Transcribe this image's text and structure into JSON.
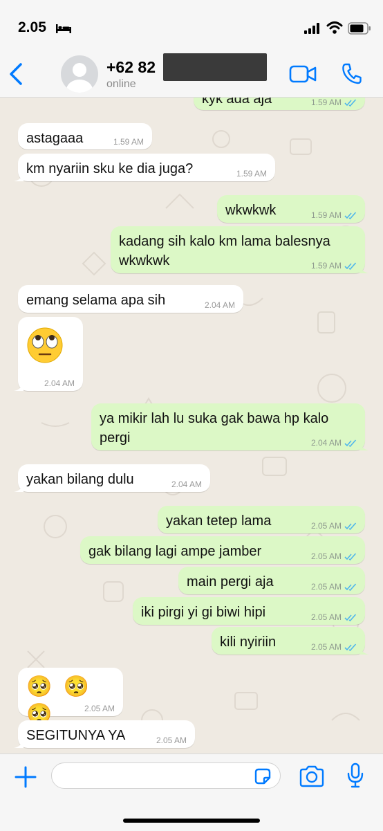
{
  "status_bar": {
    "time": "2.05",
    "icons": [
      "bed-icon",
      "cellular-signal-icon",
      "wifi-icon",
      "battery-icon"
    ]
  },
  "header": {
    "contact_number": "+62 82",
    "contact_status": "online",
    "icons": [
      "back-chevron-icon",
      "avatar-placeholder-icon",
      "video-call-icon",
      "voice-call-icon"
    ],
    "accent_color": "#007aff"
  },
  "messages": [
    {
      "dir": "out",
      "text": "kyk ada aja",
      "time": "1.59 AM",
      "read": true
    },
    {
      "dir": "in",
      "text": "astagaaa",
      "time": "1.59 AM"
    },
    {
      "dir": "in",
      "text": "km nyariin sku ke dia juga?",
      "time": "1.59 AM"
    },
    {
      "dir": "out",
      "text": "wkwkwk",
      "time": "1.59 AM",
      "read": true
    },
    {
      "dir": "out",
      "text_lines": [
        "kadang sih kalo km lama balesnya",
        "wkwkwk"
      ],
      "time": "1.59 AM",
      "read": true
    },
    {
      "dir": "in",
      "text": "emang selama apa sih",
      "time": "2.04 AM"
    },
    {
      "dir": "in",
      "emoji": "🙄",
      "time": "2.04 AM"
    },
    {
      "dir": "out",
      "text_lines": [
        "ya mikir lah lu suka gak bawa hp kalo",
        "pergi"
      ],
      "time": "2.04 AM",
      "read": true
    },
    {
      "dir": "in",
      "text": "yakan bilang dulu",
      "time": "2.04 AM"
    },
    {
      "dir": "out",
      "text": "yakan tetep lama",
      "time": "2.05 AM",
      "read": true
    },
    {
      "dir": "out",
      "text": "gak bilang lagi ampe jamber",
      "time": "2.05 AM",
      "read": true
    },
    {
      "dir": "out",
      "text": "main pergi aja",
      "time": "2.05 AM",
      "read": true
    },
    {
      "dir": "out",
      "text": "iki pirgi yi gi biwi hipi",
      "time": "2.05 AM",
      "read": true
    },
    {
      "dir": "out",
      "text": "kili nyiriin",
      "time": "2.05 AM",
      "read": true
    },
    {
      "dir": "in",
      "emoji": "🥺 🥺 🥺",
      "time": "2.05 AM"
    },
    {
      "dir": "in",
      "text": "SEGITUNYA YA",
      "time": "2.05 AM"
    }
  ],
  "input_bar": {
    "placeholder": "",
    "icons": [
      "plus-icon",
      "sticker-icon",
      "camera-icon",
      "microphone-icon"
    ]
  },
  "colors": {
    "outgoing_bubble": "#dcf8c6",
    "incoming_bubble": "#ffffff",
    "chat_background": "#efeae2",
    "read_ticks": "#4fb6ec"
  }
}
